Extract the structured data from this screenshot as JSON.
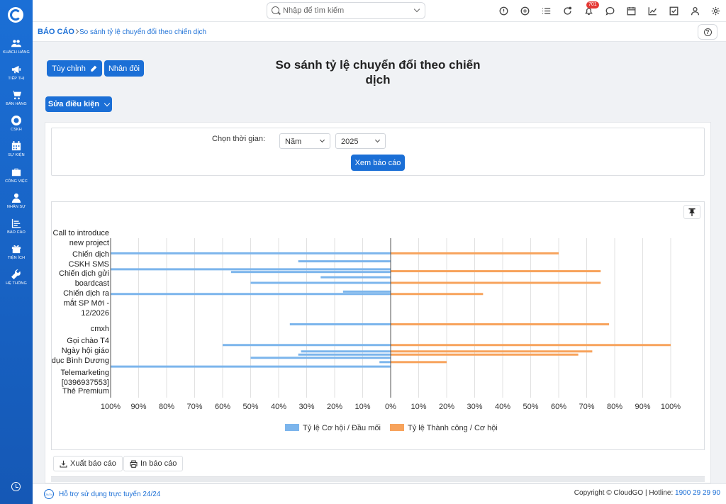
{
  "sidebar": {
    "items": [
      {
        "label": "Khách hàng",
        "icon": "users-icon"
      },
      {
        "label": "Tiếp thị",
        "icon": "megaphone-icon"
      },
      {
        "label": "Bán hàng",
        "icon": "cart-icon"
      },
      {
        "label": "CSKH",
        "icon": "lifebuoy-icon"
      },
      {
        "label": "Sự kiện",
        "icon": "calendar-icon"
      },
      {
        "label": "Công việc",
        "icon": "briefcase-icon"
      },
      {
        "label": "Nhân sự",
        "icon": "person-icon"
      },
      {
        "label": "Báo cáo",
        "icon": "report-icon"
      },
      {
        "label": "Tiện ích",
        "icon": "gift-icon"
      },
      {
        "label": "Hệ thống",
        "icon": "wrench-icon"
      }
    ]
  },
  "topbar": {
    "search_placeholder": "Nhập để tìm kiếm",
    "notification_count": "701"
  },
  "breadcrumb": {
    "root": "BÁO CÁO",
    "current": "So sánh tỷ lệ chuyển đổi theo chiến dịch"
  },
  "actions": {
    "customize": "Tùy chỉnh",
    "duplicate": "Nhân đôi",
    "edit_conditions": "Sửa điều kiện"
  },
  "report": {
    "title": "So sánh tỷ lệ chuyển đổi theo chiến dịch"
  },
  "filter": {
    "label": "Chọn thời gian:",
    "period": "Năm",
    "year": "2025",
    "view_button": "Xem báo cáo"
  },
  "chart_data": {
    "type": "bar",
    "orientation": "horizontal-butterfly",
    "y_axis_labels": [
      {
        "lines": [
          "Call to introduce",
          "new project"
        ]
      },
      {
        "lines": [
          "Chiến dịch",
          "CSKH SMS"
        ]
      },
      {
        "lines": [
          "Chiến dịch gửi",
          "boardcast"
        ]
      },
      {
        "lines": [
          "Chiến dịch ra",
          "mắt SP Mới -",
          "12/2026"
        ]
      },
      {
        "lines": [
          "cmxh"
        ]
      },
      {
        "lines": [
          "Gọi chào T4"
        ]
      },
      {
        "lines": [
          "Ngày hội giáo",
          "dục Bình Dương"
        ]
      },
      {
        "lines": [
          "Telemarketing",
          "[0396937553]"
        ]
      },
      {
        "lines": [
          "Thẻ Premium"
        ]
      }
    ],
    "x_ticks": [
      "100%",
      "90%",
      "80%",
      "70%",
      "60%",
      "50%",
      "40%",
      "30%",
      "20%",
      "10%",
      "0%",
      "10%",
      "20%",
      "30%",
      "40%",
      "50%",
      "60%",
      "70%",
      "80%",
      "90%",
      "100%"
    ],
    "xlim": [
      -100,
      100
    ],
    "series": [
      {
        "name": "Tỷ lệ Cơ hội / Đầu mối",
        "color": "#7cb5ec"
      },
      {
        "name": "Tỷ lệ Thành công / Cơ hội",
        "color": "#f7a35c"
      }
    ],
    "bars": [
      {
        "side": "left",
        "value": 100,
        "row_pos": 0.095
      },
      {
        "side": "right",
        "value": 60,
        "row_pos": 0.095
      },
      {
        "side": "left",
        "value": 33,
        "row_pos": 0.145
      },
      {
        "side": "left",
        "value": 100,
        "row_pos": 0.195
      },
      {
        "side": "left",
        "value": 57,
        "row_pos": 0.212
      },
      {
        "side": "right",
        "value": 75,
        "row_pos": 0.207
      },
      {
        "side": "left",
        "value": 25,
        "row_pos": 0.245
      },
      {
        "side": "left",
        "value": 50,
        "row_pos": 0.28
      },
      {
        "side": "right",
        "value": 75,
        "row_pos": 0.28
      },
      {
        "side": "left",
        "value": 17,
        "row_pos": 0.335
      },
      {
        "side": "left",
        "value": 100,
        "row_pos": 0.35
      },
      {
        "side": "right",
        "value": 33,
        "row_pos": 0.35
      },
      {
        "side": "left",
        "value": 36,
        "row_pos": 0.54
      },
      {
        "side": "right",
        "value": 78,
        "row_pos": 0.54
      },
      {
        "side": "left",
        "value": 60,
        "row_pos": 0.67
      },
      {
        "side": "right",
        "value": 100,
        "row_pos": 0.67
      },
      {
        "side": "left",
        "value": 32,
        "row_pos": 0.71
      },
      {
        "side": "right",
        "value": 72,
        "row_pos": 0.71
      },
      {
        "side": "left",
        "value": 33,
        "row_pos": 0.73
      },
      {
        "side": "right",
        "value": 67,
        "row_pos": 0.73
      },
      {
        "side": "left",
        "value": 50,
        "row_pos": 0.75
      },
      {
        "side": "left",
        "value": 4,
        "row_pos": 0.777
      },
      {
        "side": "right",
        "value": 20,
        "row_pos": 0.777
      },
      {
        "side": "left",
        "value": 100,
        "row_pos": 0.805
      }
    ],
    "grid": true,
    "legend_position": "bottom-center"
  },
  "bottom_actions": {
    "export": "Xuất báo cáo",
    "print": "In báo cáo"
  },
  "footer": {
    "support_badge": "24/24",
    "support_text": "Hỗ trợ sử dụng trực tuyến 24/24",
    "copyright": "Copyright © CloudGO",
    "hotline_label": "Hotline:",
    "hotline": "1900 29 29 90"
  }
}
